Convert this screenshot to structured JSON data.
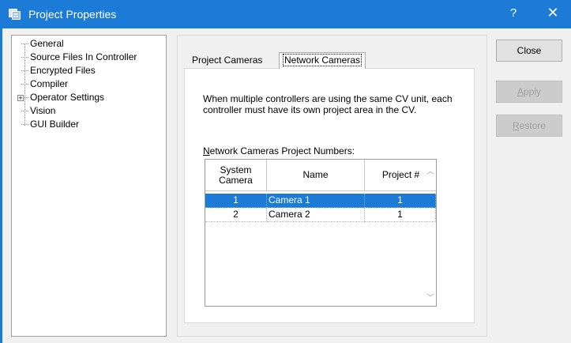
{
  "window": {
    "title": "Project Properties",
    "help_label": "?",
    "close_label": "✕",
    "app_icon": "project-properties-icon",
    "accent_color": "#1c7bd6"
  },
  "tree": {
    "items": [
      {
        "label": "General"
      },
      {
        "label": "Source Files In Controller"
      },
      {
        "label": "Encrypted Files"
      },
      {
        "label": "Compiler"
      },
      {
        "label": "Operator Settings",
        "expandable": true,
        "expander": "+"
      },
      {
        "label": "Vision"
      },
      {
        "label": "GUI Builder"
      }
    ]
  },
  "tabs": [
    {
      "label": "Project Cameras",
      "active": false
    },
    {
      "label": "Network Cameras",
      "active": true
    }
  ],
  "page": {
    "description": "When multiple controllers are using the same CV unit, each controller must have its own project area in the CV.",
    "grid_label_first": "N",
    "grid_label_rest": "etwork Cameras Project Numbers:"
  },
  "grid": {
    "columns": [
      "System Camera",
      "Name",
      "Project #"
    ],
    "rows": [
      {
        "system": "1",
        "name": "Camera 1",
        "project": "1",
        "selected": true
      },
      {
        "system": "2",
        "name": "Camera 2",
        "project": "1",
        "selected": false
      }
    ],
    "selection_color": "#1c7bd6"
  },
  "buttons": {
    "close": "Close",
    "apply_first": "A",
    "apply_rest": "pply",
    "restore_first": "R",
    "restore_rest": "estore"
  }
}
